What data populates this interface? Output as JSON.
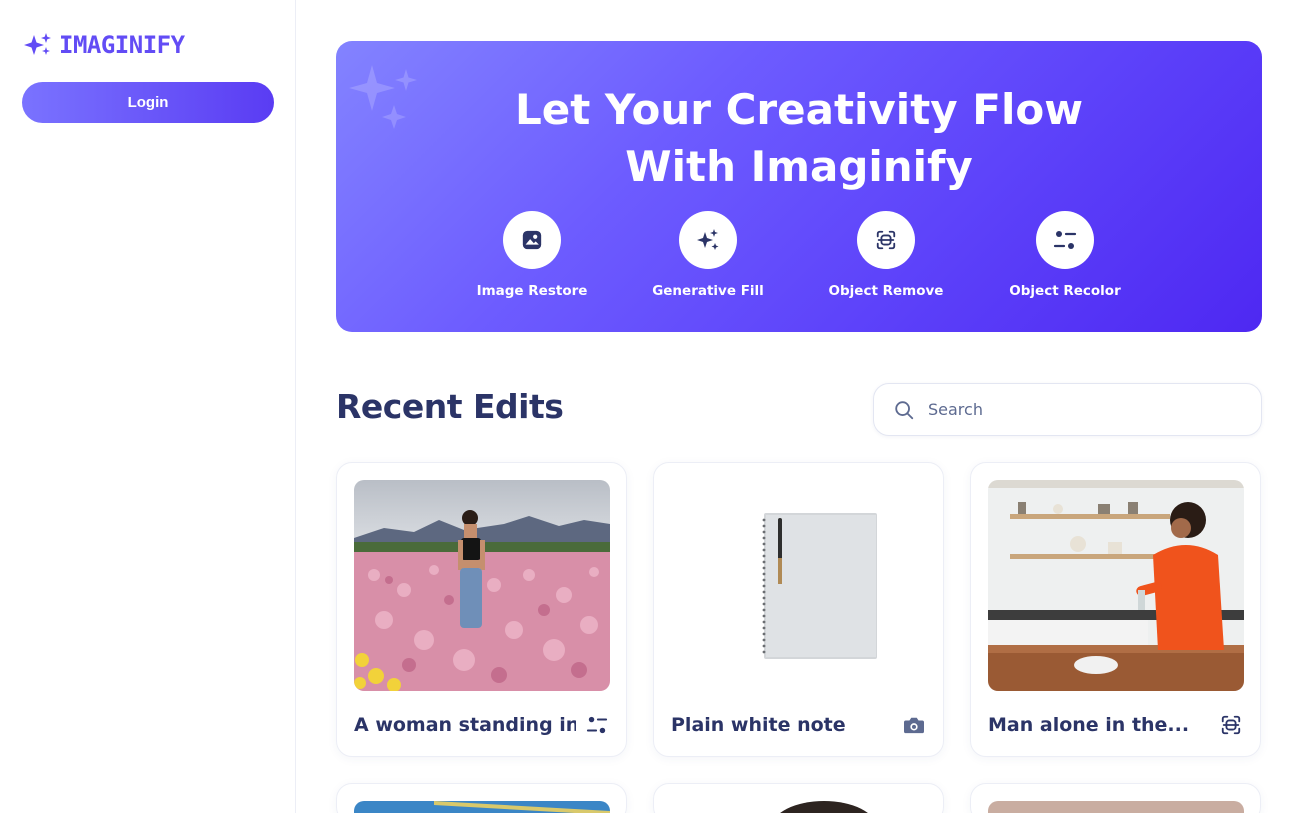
{
  "brand": {
    "name": "IMAGINIFY",
    "color": "#624cf5"
  },
  "sidebar": {
    "login_label": "Login"
  },
  "banner": {
    "title_line1": "Let Your Creativity Flow",
    "title_line2": "With Imaginify",
    "tools": [
      {
        "label": "Image Restore",
        "icon": "image-icon"
      },
      {
        "label": "Generative Fill",
        "icon": "stars-icon"
      },
      {
        "label": "Object Remove",
        "icon": "scan-icon"
      },
      {
        "label": "Object Recolor",
        "icon": "filter-icon"
      }
    ]
  },
  "recent": {
    "title": "Recent Edits",
    "search_placeholder": "Search",
    "cards": [
      {
        "title": "A woman standing in ...",
        "type_icon": "filter-icon",
        "image": "woman in pink flower field"
      },
      {
        "title": "Plain white note",
        "type_icon": "camera-icon",
        "image": "white spiral notebook with pen"
      },
      {
        "title": "Man alone in the...",
        "type_icon": "scan-icon",
        "image": "person in orange sweater in kitchen"
      }
    ]
  }
}
